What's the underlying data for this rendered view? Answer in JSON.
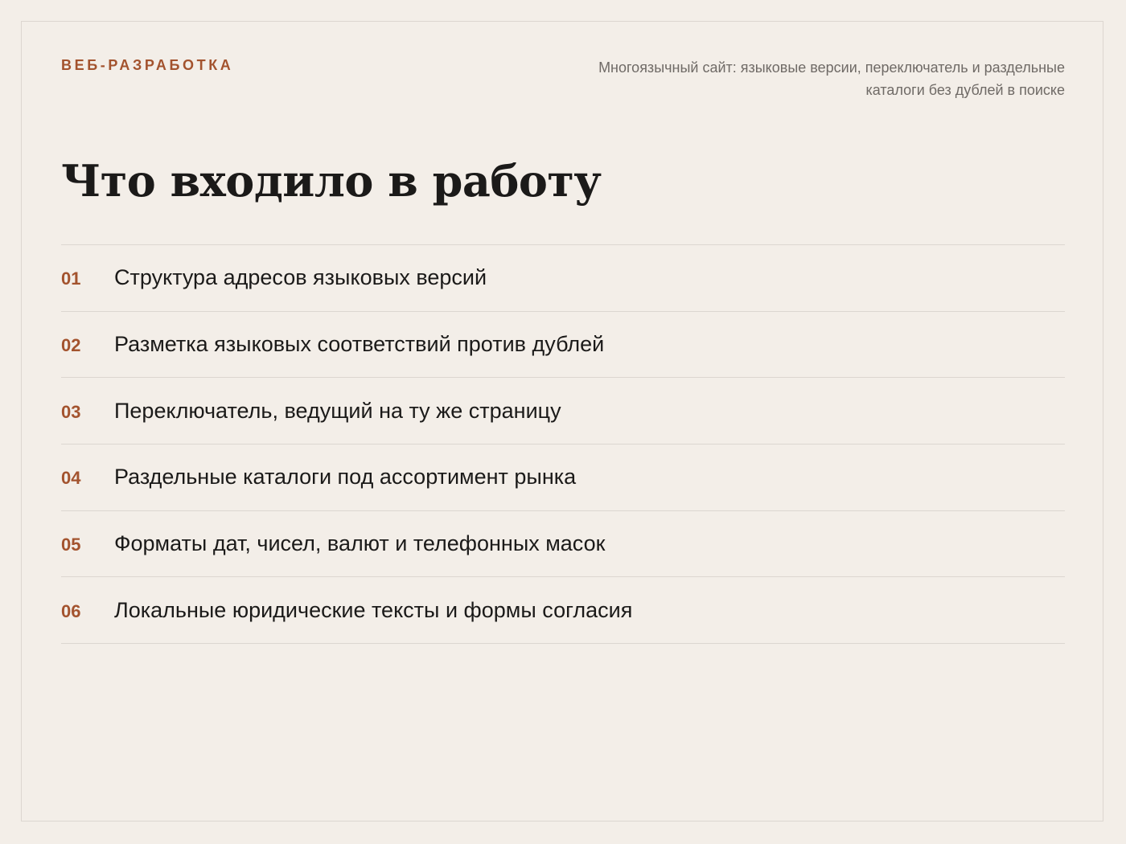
{
  "header": {
    "tag": "ВЕБ-РАЗРАБОТКА",
    "subtitle": "Многоязычный сайт: языковые версии, переключатель и раздельные каталоги без дублей в поиске"
  },
  "main": {
    "title": "Что входило в работу",
    "items": [
      {
        "num": "01",
        "text": "Структура адресов языковых версий"
      },
      {
        "num": "02",
        "text": "Разметка языковых соответствий против дублей"
      },
      {
        "num": "03",
        "text": "Переключатель, ведущий на ту же страницу"
      },
      {
        "num": "04",
        "text": "Раздельные каталоги под ассортимент рынка"
      },
      {
        "num": "05",
        "text": "Форматы дат, чисел, валют и телефонных масок"
      },
      {
        "num": "06",
        "text": "Локальные юридические тексты и формы согласия"
      }
    ]
  }
}
